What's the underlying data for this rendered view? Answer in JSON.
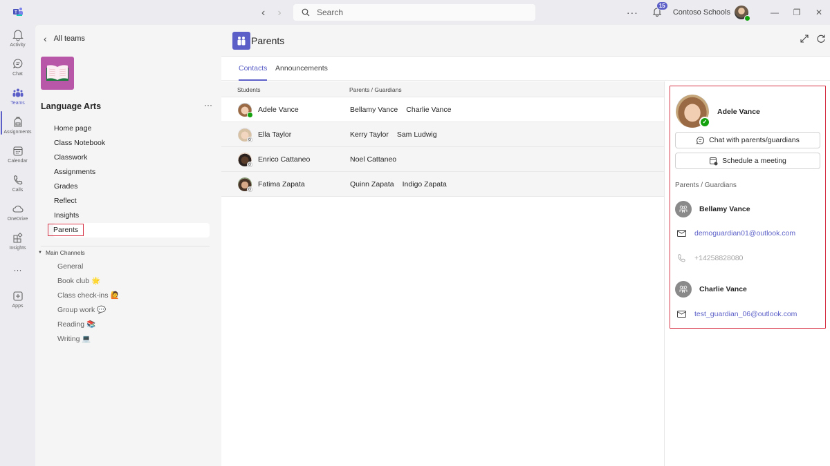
{
  "titlebar": {
    "search_placeholder": "Search",
    "notification_count": "15",
    "org_name": "Contoso Schools",
    "more_label": "···"
  },
  "rail": {
    "items": [
      {
        "label": "Activity",
        "icon": "bell-icon"
      },
      {
        "label": "Chat",
        "icon": "chat-icon"
      },
      {
        "label": "Teams",
        "icon": "teams-icon",
        "active": true
      },
      {
        "label": "Assignments",
        "icon": "backpack-icon"
      },
      {
        "label": "Calendar",
        "icon": "calendar-icon"
      },
      {
        "label": "Calls",
        "icon": "phone-icon"
      },
      {
        "label": "OneDrive",
        "icon": "cloud-icon"
      },
      {
        "label": "Insights",
        "icon": "insights-icon"
      },
      {
        "label": "···",
        "icon": "more-icon"
      },
      {
        "label": "Apps",
        "icon": "add-app-icon"
      }
    ]
  },
  "leftpane": {
    "back_label": "All teams",
    "team_name": "Language Arts",
    "tabs": [
      "Home page",
      "Class Notebook",
      "Classwork",
      "Assignments",
      "Grades",
      "Reflect",
      "Insights",
      "Parents"
    ],
    "selected_tab": "Parents",
    "channels_header": "Main Channels",
    "channels": [
      {
        "name": "General",
        "emoji": ""
      },
      {
        "name": "Book club",
        "emoji": "🌟"
      },
      {
        "name": "Class check-ins",
        "emoji": "🙋"
      },
      {
        "name": "Group work",
        "emoji": "💬"
      },
      {
        "name": "Reading",
        "emoji": "📚"
      },
      {
        "name": "Writing",
        "emoji": "💻"
      }
    ]
  },
  "main": {
    "app_title": "Parents",
    "tabs": [
      {
        "label": "Contacts",
        "active": true
      },
      {
        "label": "Announcements",
        "active": false
      }
    ],
    "table": {
      "headers": [
        "Students",
        "Parents / Guardians"
      ],
      "rows": [
        {
          "student": "Adele Vance",
          "guardians": [
            "Bellamy Vance",
            "Charlie Vance"
          ],
          "status": "available",
          "selected": true
        },
        {
          "student": "Ella Taylor",
          "guardians": [
            "Kerry Taylor",
            "Sam Ludwig"
          ],
          "status": "offline",
          "selected": false
        },
        {
          "student": "Enrico Cattaneo",
          "guardians": [
            "Noel Cattaneo"
          ],
          "status": "offline",
          "selected": false
        },
        {
          "student": "Fatima Zapata",
          "guardians": [
            "Quinn Zapata",
            "Indigo Zapata"
          ],
          "status": "offline",
          "selected": false
        }
      ]
    }
  },
  "detail": {
    "student_name": "Adele Vance",
    "chat_button": "Chat with parents/guardians",
    "meeting_button": "Schedule a meeting",
    "section_label": "Parents / Guardians",
    "guardians": [
      {
        "name": "Bellamy Vance",
        "email": "demoguardian01@outlook.com",
        "phone": "+14258828080"
      },
      {
        "name": "Charlie Vance",
        "email": "test_guardian_06@outlook.com"
      }
    ]
  },
  "colors": {
    "accent": "#5b5fc7",
    "highlight_border": "#d63347",
    "presence_available": "#13a10e",
    "team_icon_bg": "#b857a8"
  }
}
